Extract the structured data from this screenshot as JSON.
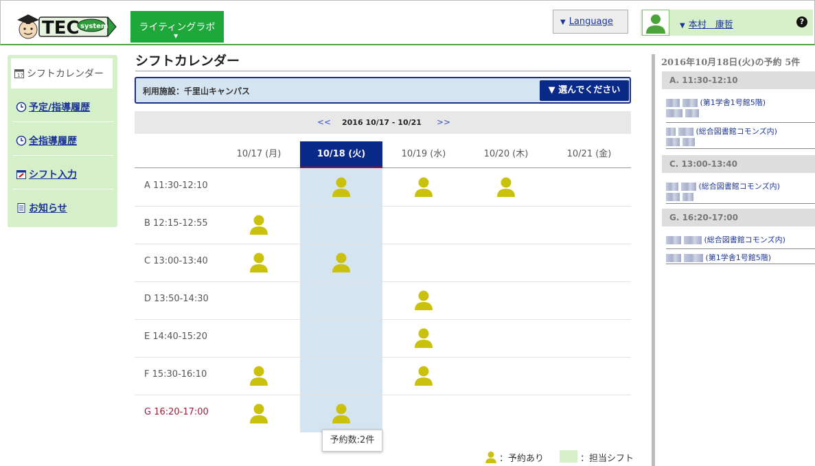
{
  "header": {
    "logo_text": "TEC system",
    "app_button": "ライティングラボ",
    "language_label": "Language",
    "user_name": "本村　康哲",
    "help_glyph": "?"
  },
  "sidebar": {
    "items": [
      {
        "label": "シフトカレンダー",
        "icon": "calendar-icon",
        "active": true
      },
      {
        "label": "予定/指導履歴",
        "icon": "clock-icon"
      },
      {
        "label": "全指導履歴",
        "icon": "clock-icon"
      },
      {
        "label": "シフト入力",
        "icon": "calendar-edit-icon"
      },
      {
        "label": "お知らせ",
        "icon": "document-icon"
      }
    ]
  },
  "main": {
    "title": "シフトカレンダー",
    "facility_label": "利用施設：千里山キャンパス",
    "facility_select": "▼ 選んでください",
    "week_prev": "<<",
    "week_label": "2016 10/17 - 10/21",
    "week_next": ">>",
    "days": [
      "10/17 (月)",
      "10/18 (火)",
      "10/19 (水)",
      "10/20 (木)",
      "10/21 (金)"
    ],
    "today_index": 1,
    "slots": [
      {
        "label": "A 11:30-12:10",
        "booked": [
          false,
          true,
          true,
          true,
          false
        ]
      },
      {
        "label": "B 12:15-12:55",
        "booked": [
          true,
          false,
          false,
          false,
          false
        ]
      },
      {
        "label": "C 13:00-13:40",
        "booked": [
          true,
          true,
          false,
          false,
          false
        ]
      },
      {
        "label": "D 13:50-14:30",
        "booked": [
          false,
          false,
          true,
          false,
          false
        ]
      },
      {
        "label": "E 14:40-15:20",
        "booked": [
          false,
          false,
          true,
          false,
          false
        ]
      },
      {
        "label": "F 15:30-16:10",
        "booked": [
          true,
          false,
          true,
          false,
          false
        ]
      },
      {
        "label": "G 16:20-17:00",
        "booked": [
          true,
          true,
          false,
          false,
          false
        ],
        "current": true
      }
    ],
    "tooltip": "予約数:2件",
    "legend": {
      "booked": "：予約あり",
      "shift": "：担当シフト"
    },
    "colors": {
      "navy": "#0a2a8a",
      "person": "#c9c10c",
      "shift": "#d5efc9",
      "today_col": "#d5e4f1"
    }
  },
  "right_panel": {
    "title": "2016年10月18日(火)の予約 5件",
    "groups": [
      {
        "slot": "A. 11:30-12:10",
        "entries": [
          {
            "place": "(第1学舎1号館5階)"
          },
          {
            "place": "(総合図書館コモンズ内)"
          }
        ]
      },
      {
        "slot": "C. 13:00-13:40",
        "entries": [
          {
            "place": "(総合図書館コモンズ内)"
          }
        ]
      },
      {
        "slot": "G. 16:20-17:00",
        "entries": [
          {
            "place": "(総合図書館コモンズ内)"
          },
          {
            "place": "(第1学舎1号館5階)"
          }
        ]
      }
    ]
  }
}
